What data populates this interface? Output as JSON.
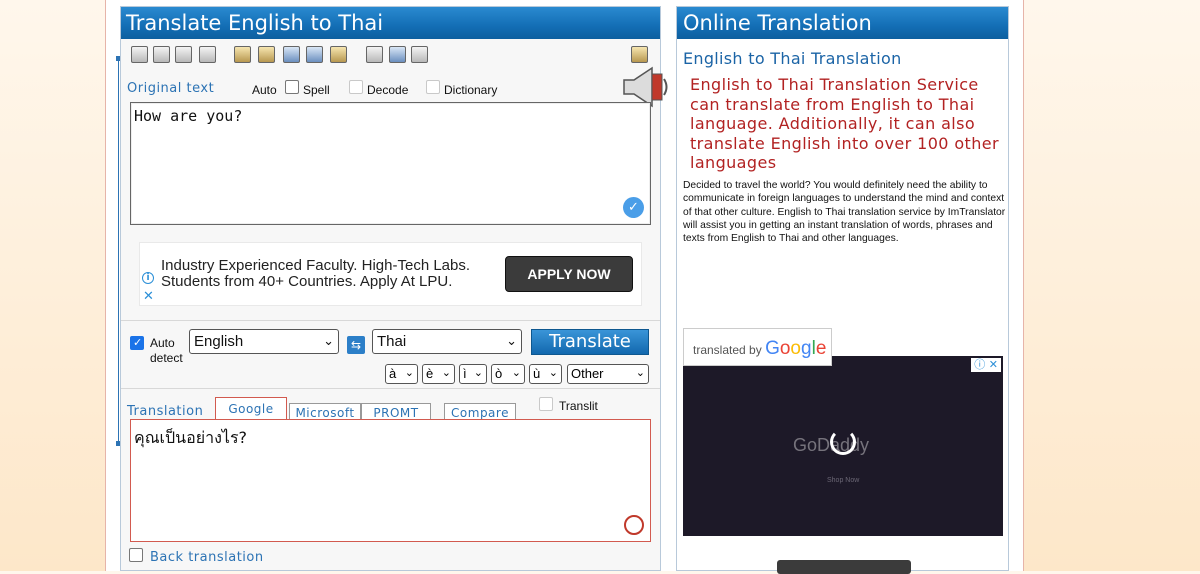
{
  "left_panel": {
    "title": "Translate English to Thai",
    "original_text_label": "Original text",
    "options": {
      "auto": "Auto",
      "spell": "Spell",
      "decode": "Decode",
      "dictionary": "Dictionary"
    },
    "source_text": "How are you?",
    "ad": {
      "line1": "Industry Experienced Faculty. High-Tech Labs.",
      "line2": "Students from 40+ Countries. Apply At LPU.",
      "button": "APPLY NOW"
    },
    "auto_detect_label_1": "Auto",
    "auto_detect_label_2": "detect",
    "source_language": "English",
    "target_language": "Thai",
    "translate_button": "Translate",
    "accent_selects": [
      "à",
      "è",
      "ì",
      "ò",
      "ù"
    ],
    "other_select": "Other",
    "translation_label": "Translation",
    "tabs": [
      "Google",
      "Microsoft",
      "PROMT",
      "Compare"
    ],
    "translit_label": "Translit",
    "translated_text": "คุณเป็นอย่างไร?",
    "back_translation_label": "Back translation"
  },
  "right_panel": {
    "title": "Online Translation",
    "subtitle": "English to Thai Translation",
    "highlight": "English to Thai Translation Service can translate from English to Thai language. Additionally, it can also translate English into over 100 other languages",
    "body": "Decided to travel the world? You would definitely need the ability to communicate in foreign languages to understand the mind and context of that other culture. English to Thai translation service by ImTranslator will assist you in getting an instant translation of words, phrases and texts from English to Thai and other languages.",
    "translated_by": "translated by",
    "google": "Google",
    "video_brand": "GoDaddy",
    "video_shop": "Shop Now"
  }
}
